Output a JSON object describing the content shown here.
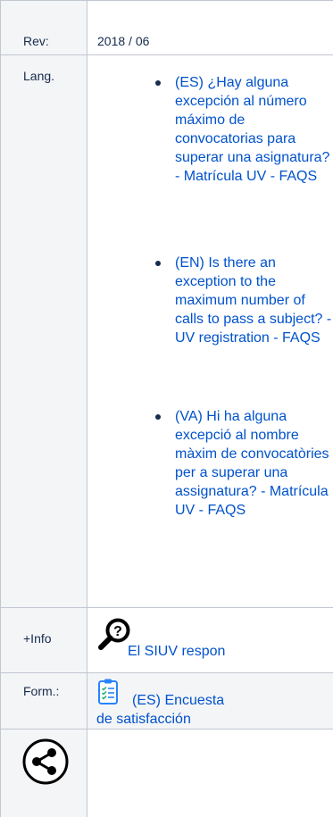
{
  "rows": {
    "rev": {
      "label": "Rev:",
      "value": "2018 / 06"
    },
    "lang": {
      "label": "Lang.",
      "links": [
        {
          "text": "(ES) ¿Hay alguna excepción al número máximo de convocatorias para superar una asignatura? - Matrícula UV - FAQS"
        },
        {
          "text": "(EN) Is there an exception to the maximum number of calls to pass a subject? - UV registration - FAQS"
        },
        {
          "text": "(VA) Hi ha alguna excepció al nombre màxim de convocatòries per a superar una assignatura? - Matrícula UV - FAQS"
        }
      ]
    },
    "info": {
      "label": "+Info",
      "link": "El SIUV respon",
      "icon": "magnifier-question-icon"
    },
    "form": {
      "label": "Form.:",
      "link": "(ES) Encuesta de satisfacción",
      "icon": "clipboard-checklist-icon"
    },
    "share": {
      "icon": "share-icon"
    }
  }
}
